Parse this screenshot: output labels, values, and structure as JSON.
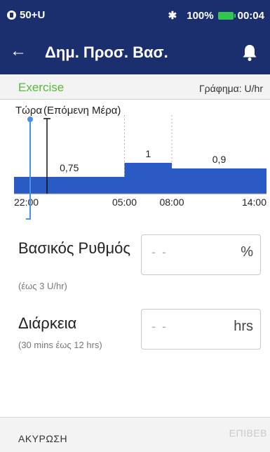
{
  "status_bar": {
    "carrier": "50+U",
    "battery": "100%",
    "time": "00:04",
    "icons": [
      "sim-icon",
      "bluetooth-icon",
      "battery-icon"
    ]
  },
  "app_bar": {
    "title": "Δημ. Προσ. Βασ.",
    "back_icon": "arrow-left-icon",
    "bell_icon": "bell-icon"
  },
  "chart_header": {
    "mode": "Exercise",
    "graph_label": "Γράφημα: U/hr"
  },
  "chart_data": {
    "type": "bar",
    "now_label": "Τώρα",
    "next_day_label": "(Επόμενη Μέρα)",
    "segments": [
      {
        "start": "22:00",
        "end": "05:00",
        "value": 0.75,
        "label": "0,75"
      },
      {
        "start": "05:00",
        "end": "08:00",
        "value": 1,
        "label": "1"
      },
      {
        "start": "08:00",
        "end": "14:00",
        "value": 0.9,
        "label": "0,9"
      }
    ],
    "x_ticks": [
      "22:00",
      "05:00",
      "08:00",
      "14:00"
    ],
    "colors": {
      "bar": "#2a5bc4",
      "now_marker": "#4a8fe8",
      "midnight_marker": "#111111"
    }
  },
  "form": {
    "basal_rate": {
      "label": "Βασικός Ρυθμός",
      "hint": "(έως 3 U/hr)",
      "placeholder": "- -",
      "unit": "%"
    },
    "duration": {
      "label": "Διάρκεια",
      "hint": "(30 mins έως 12 hrs)",
      "placeholder": "- -",
      "unit": "hrs"
    }
  },
  "footer": {
    "cancel": "ΑΚΥΡΩΣΗ",
    "next": "ΕΠΙΒΕΒ"
  },
  "colors": {
    "primary": "#1b2f6e",
    "accent_green": "#57b83a",
    "bar_blue": "#2a5bc4"
  }
}
